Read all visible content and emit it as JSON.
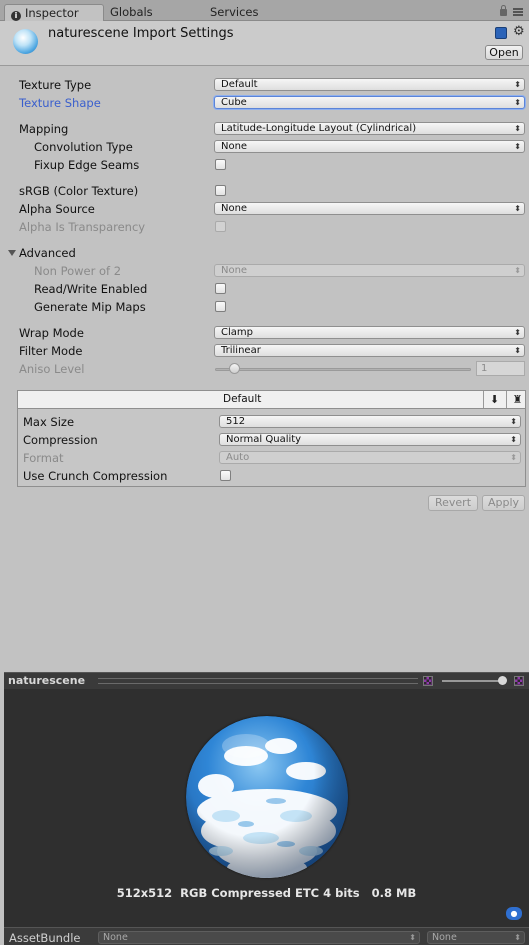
{
  "tabs": [
    {
      "label": "Inspector",
      "active": true
    },
    {
      "label": "Globals",
      "active": false
    },
    {
      "label": "Services",
      "active": false
    }
  ],
  "header": {
    "title": "naturescene Import Settings",
    "open_label": "Open"
  },
  "settings": {
    "texture_type": {
      "label": "Texture Type",
      "value": "Default"
    },
    "texture_shape": {
      "label": "Texture Shape",
      "value": "Cube"
    },
    "mapping": {
      "label": "Mapping",
      "value": "Latitude-Longitude Layout (Cylindrical)"
    },
    "convolution_type": {
      "label": "Convolution Type",
      "value": "None"
    },
    "fixup_edge_seams": {
      "label": "Fixup Edge Seams",
      "checked": false
    },
    "srgb": {
      "label": "sRGB (Color Texture)",
      "checked": false
    },
    "alpha_source": {
      "label": "Alpha Source",
      "value": "None"
    },
    "alpha_is_transparency": {
      "label": "Alpha Is Transparency",
      "checked": false
    },
    "advanced": {
      "label": "Advanced",
      "expanded": true
    },
    "non_power_of_2": {
      "label": "Non Power of 2",
      "value": "None"
    },
    "read_write": {
      "label": "Read/Write Enabled",
      "checked": false
    },
    "generate_mip_maps": {
      "label": "Generate Mip Maps",
      "checked": false
    },
    "wrap_mode": {
      "label": "Wrap Mode",
      "value": "Clamp"
    },
    "filter_mode": {
      "label": "Filter Mode",
      "value": "Trilinear"
    },
    "aniso_level": {
      "label": "Aniso Level",
      "value": "1"
    }
  },
  "platform": {
    "title": "Default",
    "max_size": {
      "label": "Max Size",
      "value": "512"
    },
    "compression": {
      "label": "Compression",
      "value": "Normal Quality"
    },
    "format": {
      "label": "Format",
      "value": "Auto"
    },
    "crunch": {
      "label": "Use Crunch Compression",
      "checked": false
    }
  },
  "actions": {
    "revert": "Revert",
    "apply": "Apply"
  },
  "preview": {
    "title": "naturescene",
    "info": "512x512  RGB Compressed ETC 4 bits   0.8 MB"
  },
  "asset_bundle": {
    "label": "AssetBundle",
    "name_value": "None",
    "variant_value": "None"
  },
  "colors": {
    "inspector_bg": "#c2c2c2",
    "focus_label": "#3a5fcd",
    "preview_bg": "#2f2f2f",
    "sky_blue": "#2f86d6"
  }
}
